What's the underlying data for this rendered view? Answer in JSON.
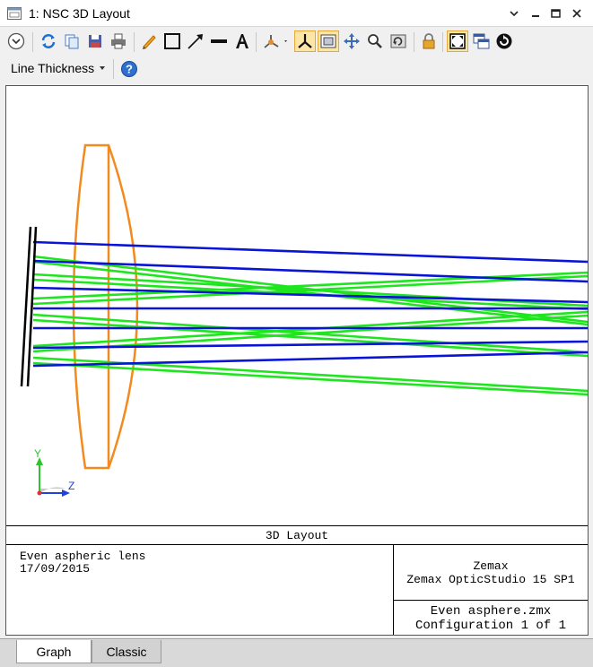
{
  "window": {
    "title": "1: NSC 3D Layout"
  },
  "toolbar": {
    "line_thickness_label": "Line Thickness"
  },
  "plot": {
    "axis_y_label": "Y",
    "axis_z_label": "Z",
    "colors": {
      "lens": "#f28a1e",
      "ray_blue": "#0a14d6",
      "ray_green": "#1ee61e",
      "detector": "#000000"
    }
  },
  "info": {
    "layout_title": "3D Layout",
    "description": "Even aspheric lens",
    "date": "17/09/2015",
    "company": "Zemax",
    "product": "Zemax OpticStudio 15 SP1",
    "file_name": "Even asphere.zmx",
    "configuration": "Configuration 1 of 1"
  },
  "tabs": [
    {
      "label": "Graph"
    },
    {
      "label": "Classic"
    }
  ]
}
